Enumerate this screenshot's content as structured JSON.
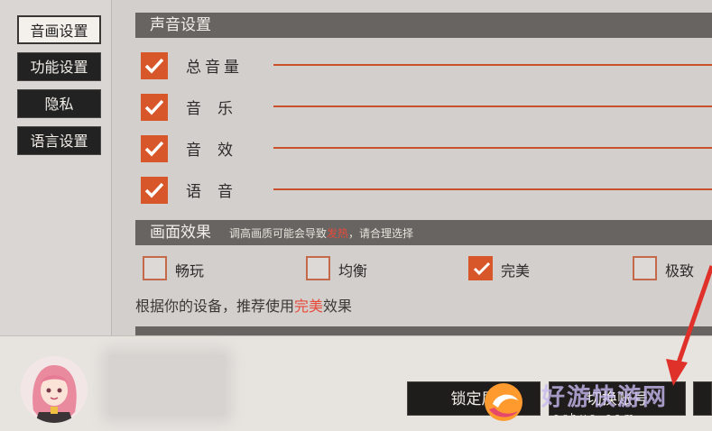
{
  "sidebar": {
    "items": [
      {
        "label": "音画设置",
        "active": true
      },
      {
        "label": "功能设置",
        "active": false
      },
      {
        "label": "隐私",
        "active": false
      },
      {
        "label": "语言设置",
        "active": false
      }
    ]
  },
  "sound": {
    "header": "声音设置",
    "rows": [
      {
        "label": "总音量",
        "checked": true
      },
      {
        "label": "音乐",
        "checked": true
      },
      {
        "label": "音效",
        "checked": true
      },
      {
        "label": "语音",
        "checked": true
      }
    ]
  },
  "graphics": {
    "header": "画面效果",
    "hint_before": "调高画质可能会导致",
    "hint_highlight": "发热",
    "hint_after": "，请合理选择",
    "options": [
      {
        "label": "畅玩",
        "checked": false
      },
      {
        "label": "均衡",
        "checked": false
      },
      {
        "label": "完美",
        "checked": true
      },
      {
        "label": "极致",
        "checked": false
      }
    ],
    "recommend_before": "根据你的设备，推荐使用",
    "recommend_highlight": "完美",
    "recommend_after": "效果"
  },
  "bottom": {
    "lock_button": "锁定屏",
    "switch_button": "切换账号"
  },
  "watermark": {
    "text": "好游快游网",
    "url": "horhys.com"
  },
  "colors": {
    "accent": "#d8572a",
    "highlight": "#e84a3a",
    "header_bg": "#676462",
    "arrow": "#e0302a"
  }
}
